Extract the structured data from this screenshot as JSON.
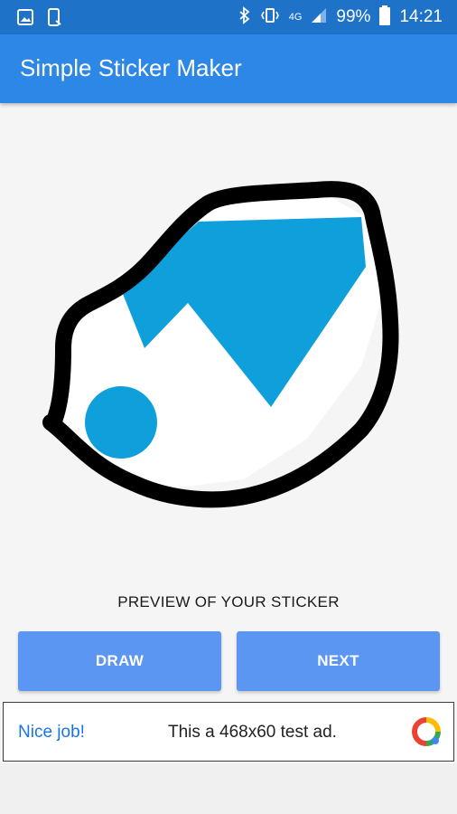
{
  "status_bar": {
    "battery": "99%",
    "time": "14:21",
    "network": "4G"
  },
  "app": {
    "title": "Simple Sticker Maker"
  },
  "preview": {
    "label": "PREVIEW OF YOUR STICKER"
  },
  "buttons": {
    "draw": "DRAW",
    "next": "NEXT"
  },
  "ad": {
    "headline": "Nice job!",
    "text": "This a 468x60 test ad."
  },
  "colors": {
    "status_bar": "#1e73c8",
    "app_bar": "#2d87e6",
    "button": "#5b96f2",
    "sticker_blue": "#0fa0dc",
    "stroke": "#000000"
  }
}
